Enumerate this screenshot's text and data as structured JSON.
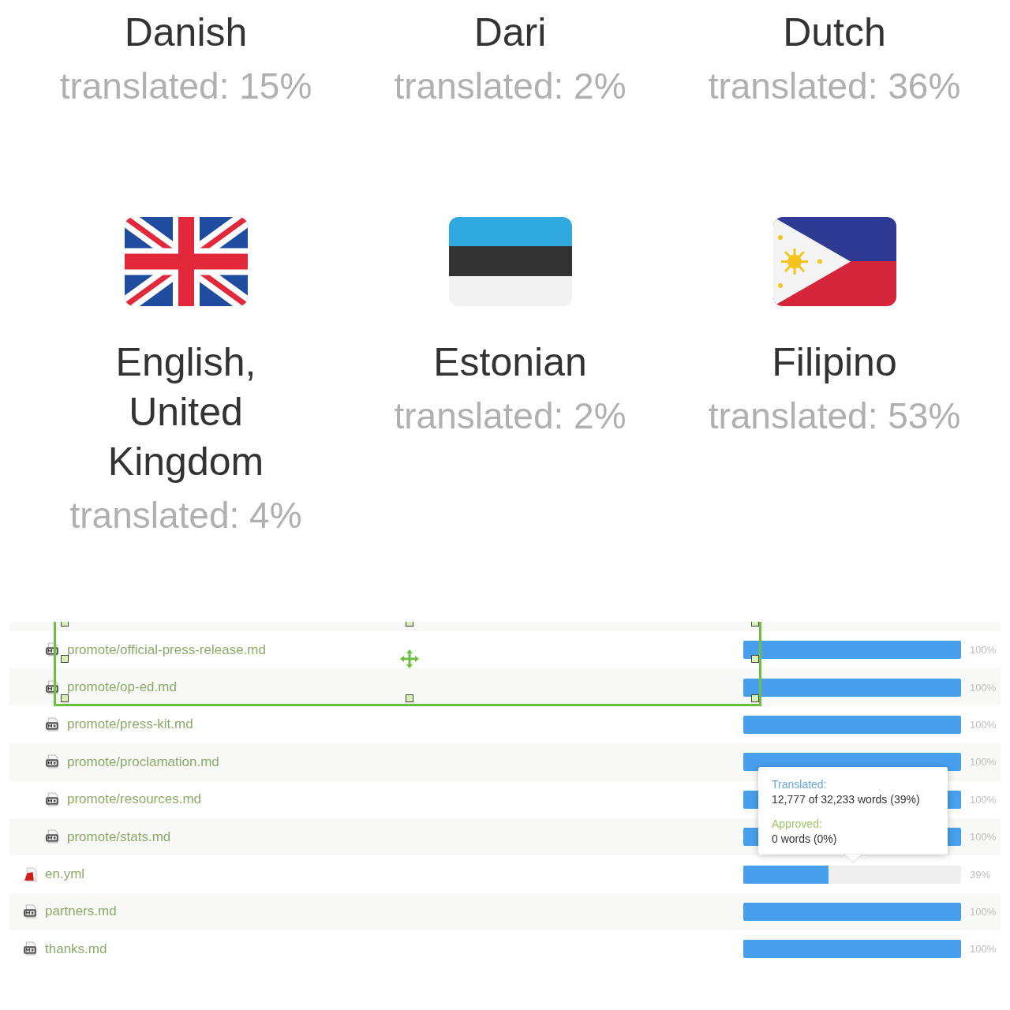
{
  "languages": [
    {
      "name": "Danish",
      "status": "translated: 15%"
    },
    {
      "name": "Dari",
      "status": "translated: 2%"
    },
    {
      "name": "Dutch",
      "status": "translated: 36%"
    },
    {
      "name": "English, United Kingdom",
      "status": "translated: 4%",
      "kind": "uk"
    },
    {
      "name": "Estonian",
      "status": "translated: 2%",
      "kind": "estonia"
    },
    {
      "name": "Filipino",
      "status": "translated: 53%",
      "kind": "philippines"
    }
  ],
  "file_list": {
    "folder_children": [
      {
        "name": "promote/official-press-release.md",
        "kind": "markdown",
        "level": 1,
        "reading": "100%"
      },
      {
        "name": "promote/op-ed.md",
        "kind": "markdown",
        "level": 1,
        "reading": "100%"
      },
      {
        "name": "promote/press-kit.md",
        "kind": "markdown",
        "level": 1,
        "reading": "100%"
      },
      {
        "name": "promote/proclamation.md",
        "kind": "markdown",
        "level": 1,
        "reading": "100%"
      },
      {
        "name": "promote/resources.md",
        "kind": "markdown",
        "level": 1,
        "reading": "100%"
      },
      {
        "name": "promote/stats.md",
        "kind": "markdown",
        "level": 1,
        "reading": "100%"
      }
    ],
    "root_files": [
      {
        "name": "en.yml",
        "kind": "yaml",
        "level": 0.39,
        "reading": "39%"
      },
      {
        "name": "partners.md",
        "kind": "markdown",
        "level": 1,
        "reading": "100%"
      },
      {
        "name": "thanks.md",
        "kind": "markdown",
        "level": 1,
        "reading": "100%"
      }
    ]
  },
  "tooltip": {
    "translated_label": "Translated:",
    "translated_value": "12,777 of 32,233 words (39%)",
    "approved_label": "Approved:",
    "approved_value": "0 words (0%)"
  }
}
